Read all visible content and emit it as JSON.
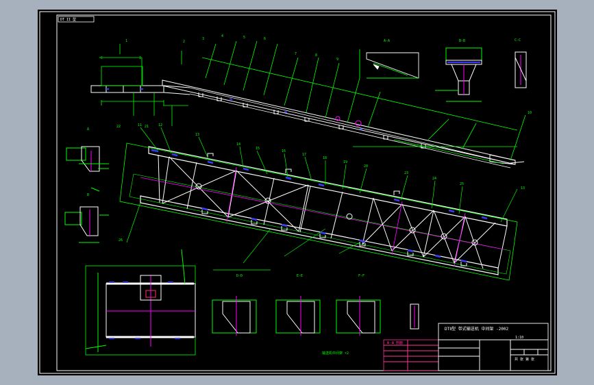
{
  "drawing": {
    "corner_tag": "DT II 型",
    "title": "DTⅡ型 带式输送机 中间架 -2002",
    "scale_note": "1:10",
    "sheet_note": "共 张 第 张",
    "spec_note": "Ⅲ-Ⅲ 剖面",
    "bottom_caption": "输送机中间架 ×2",
    "colors": {
      "background": "#000000",
      "frame": "#ffffff",
      "geometry": "#ffffff",
      "dimension": "#00ff00",
      "centerline": "#ff00ff",
      "hidden": "#0000ff",
      "annotation": "#ff2020",
      "titleblock": "#ff3399"
    }
  }
}
